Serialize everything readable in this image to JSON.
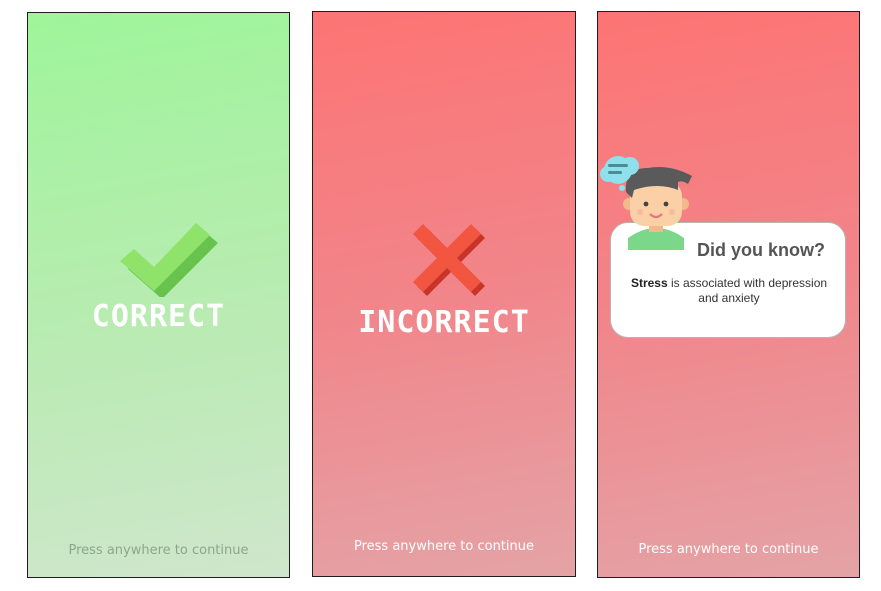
{
  "screens": [
    {
      "id": "correct",
      "result_text": "CORRECT",
      "icon": "checkmark-icon",
      "continue_text": "Press anywhere to continue"
    },
    {
      "id": "incorrect",
      "result_text": "INCORRECT",
      "icon": "cross-icon",
      "continue_text": "Press anywhere to continue"
    },
    {
      "id": "did-you-know",
      "icon": "avatar-thinking-icon",
      "card": {
        "title": "Did  you know?",
        "fact_bold": "Stress",
        "fact_rest": " is associated with depression and anxiety"
      },
      "continue_text": "Press anywhere to continue"
    }
  ],
  "colors": {
    "correct_bg_top": "#9ef59a",
    "correct_bg_bottom": "#cfe6cc",
    "incorrect_bg_top": "#fd7474",
    "incorrect_bg_bottom": "#e4a3a6",
    "check_green": "#8fe36b",
    "cross_red": "#f25540"
  }
}
